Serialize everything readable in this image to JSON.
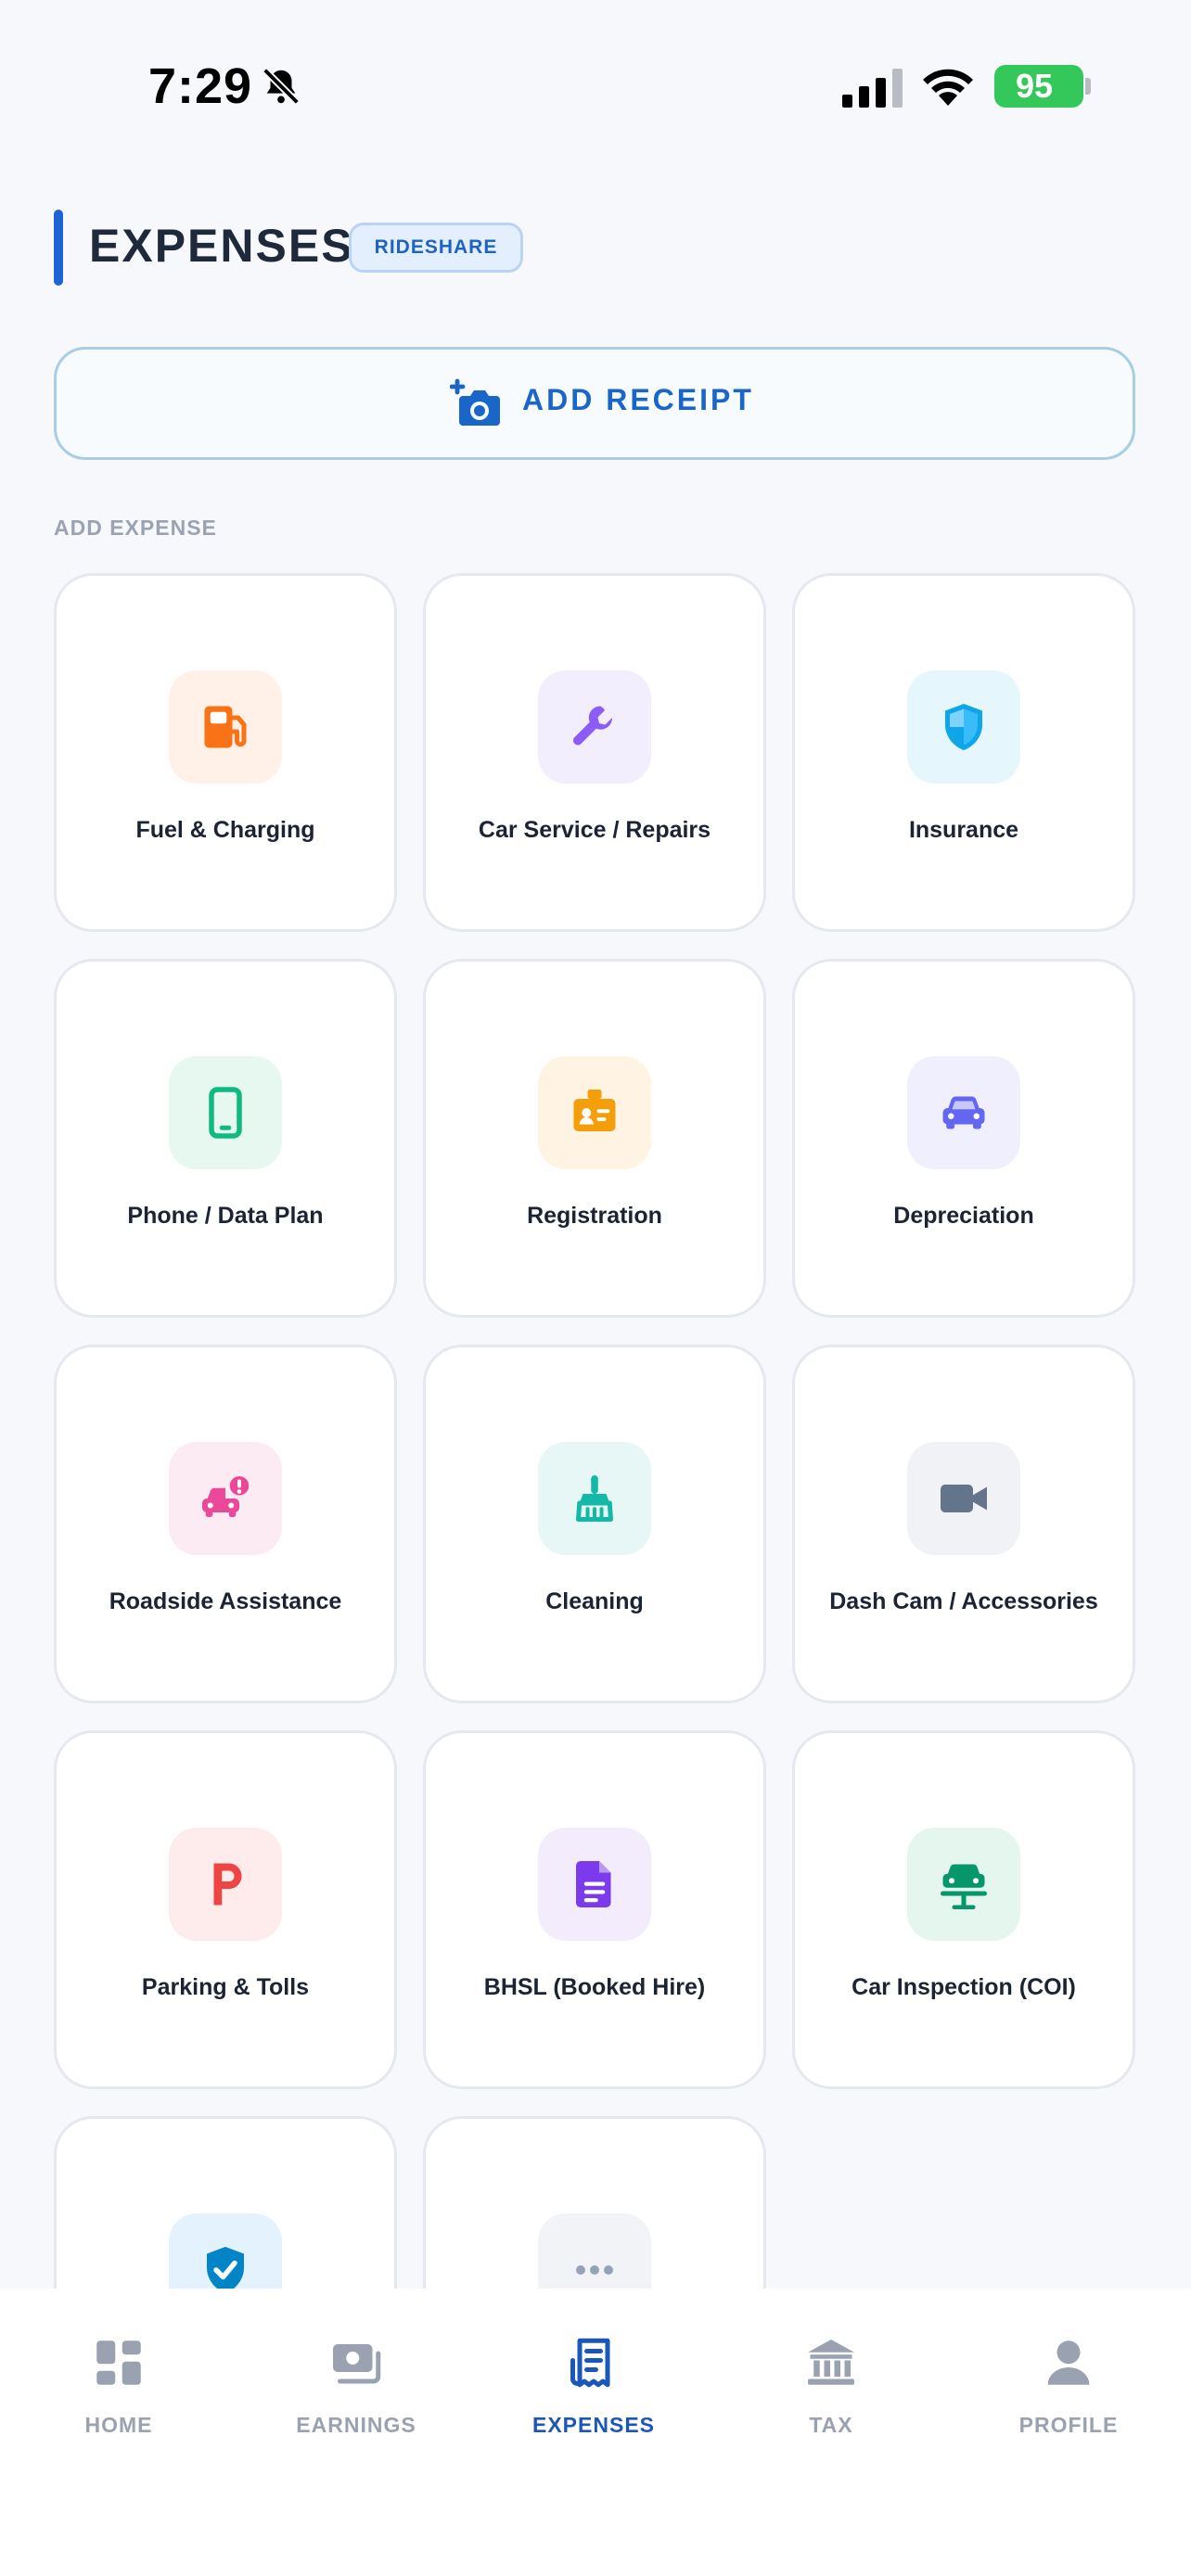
{
  "status_bar": {
    "time": "7:29",
    "battery": "95"
  },
  "header": {
    "title": "EXPENSES",
    "badge": "RIDESHARE"
  },
  "add_receipt": {
    "label": "ADD RECEIPT"
  },
  "section": {
    "label": "ADD EXPENSE"
  },
  "categories": [
    {
      "label": "Fuel & Charging",
      "icon": "fuel-pump-icon",
      "color": "#f97316",
      "bg": "#fff1e8"
    },
    {
      "label": "Car Service / Repairs",
      "icon": "wrench-icon",
      "color": "#8b5cf6",
      "bg": "#f3eefe"
    },
    {
      "label": "Insurance",
      "icon": "shield-icon",
      "color": "#0ea5e9",
      "bg": "#e6f6fd"
    },
    {
      "label": "Phone / Data Plan",
      "icon": "smartphone-icon",
      "color": "#10b981",
      "bg": "#e7f8f1"
    },
    {
      "label": "Registration",
      "icon": "id-badge-icon",
      "color": "#f59e0b",
      "bg": "#fff4e3"
    },
    {
      "label": "Depreciation",
      "icon": "car-icon",
      "color": "#6366f1",
      "bg": "#efeffd"
    },
    {
      "label": "Roadside Assistance",
      "icon": "car-alert-icon",
      "color": "#ec4899",
      "bg": "#fdebf3"
    },
    {
      "label": "Cleaning",
      "icon": "broom-icon",
      "color": "#14b8a6",
      "bg": "#e6f7f5"
    },
    {
      "label": "Dash Cam / Accessories",
      "icon": "video-camera-icon",
      "color": "#64748b",
      "bg": "#f0f2f5"
    },
    {
      "label": "Parking & Tolls",
      "icon": "parking-icon",
      "color": "#ef4444",
      "bg": "#fdeceb"
    },
    {
      "label": "BHSL (Booked Hire)",
      "icon": "document-icon",
      "color": "#7c3aed",
      "bg": "#f2ecfd"
    },
    {
      "label": "Car Inspection (COI)",
      "icon": "car-lift-icon",
      "color": "#059669",
      "bg": "#e5f6ef"
    },
    {
      "label": "",
      "icon": "shield-check-icon",
      "color": "#0284c7",
      "bg": "#e3f2fc"
    },
    {
      "label": "",
      "icon": "more-icon",
      "color": "#94a3b8",
      "bg": "#f1f3f6"
    }
  ],
  "nav": [
    {
      "label": "HOME",
      "icon": "grid-icon",
      "active": false
    },
    {
      "label": "EARNINGS",
      "icon": "cash-icon",
      "active": false
    },
    {
      "label": "EXPENSES",
      "icon": "receipt-icon",
      "active": true
    },
    {
      "label": "TAX",
      "icon": "bank-icon",
      "active": false
    },
    {
      "label": "PROFILE",
      "icon": "person-icon",
      "active": false
    }
  ],
  "colors": {
    "accent": "#1e63d6",
    "nav_active": "#1a57b8",
    "nav_inactive": "#9aa2b1",
    "battery": "#34c759"
  }
}
